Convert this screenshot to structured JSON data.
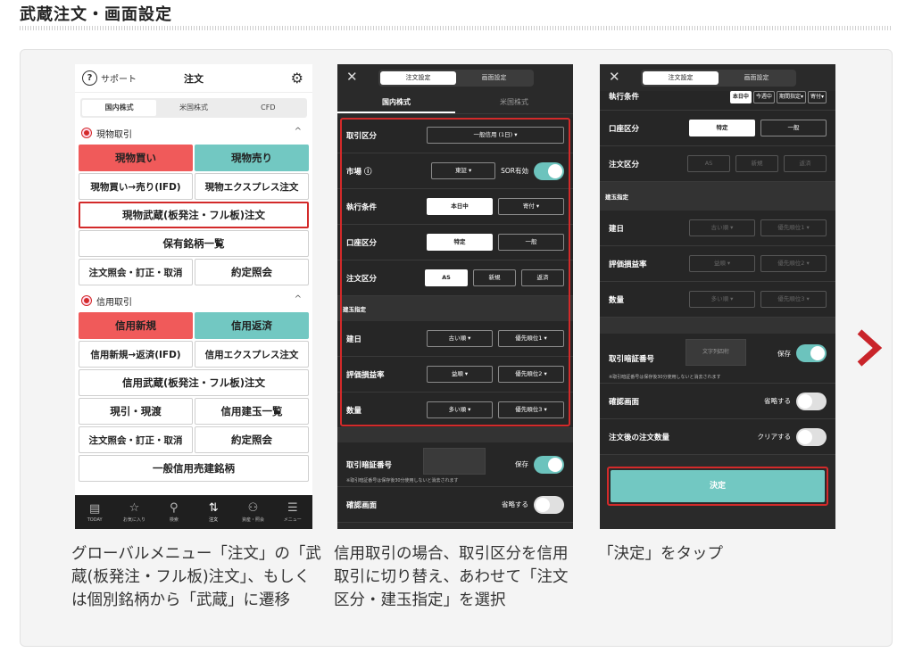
{
  "page_title": "武蔵注文・画面設定",
  "phone1": {
    "support_icon_text": "?",
    "support": "サポート",
    "title": "注文",
    "tabs": [
      "国内株式",
      "米国株式",
      "CFD"
    ],
    "section_cash": "現物取引",
    "cash_buttons": {
      "buy": "現物買い",
      "sell": "現物売り",
      "ifd": "現物買い→売り(IFD)",
      "express": "現物エクスプレス注文",
      "musashi": "現物武蔵(板発注・フル板)注文",
      "holdings": "保有銘柄一覧",
      "inquiry": "注文照会・訂正・取消",
      "execution": "約定照会"
    },
    "section_margin": "信用取引",
    "margin_buttons": {
      "new": "信用新規",
      "repay": "信用返済",
      "ifd": "信用新規→返済(IFD)",
      "express": "信用エクスプレス注文",
      "musashi": "信用武蔵(板発注・フル板)注文",
      "genbiki": "現引・現渡",
      "positions": "信用建玉一覧",
      "inquiry": "注文照会・訂正・取消",
      "execution": "約定照会",
      "short": "一般信用売建銘柄"
    },
    "tabbar": [
      "TODAY",
      "お気に入り",
      "検索",
      "注文",
      "資産・照会",
      "メニュー"
    ]
  },
  "phone2": {
    "pill": [
      "注文設定",
      "画面設定"
    ],
    "subtabs": [
      "国内株式",
      "米国株式"
    ],
    "torihiki_kubun": {
      "label": "取引区分",
      "value": "一般信用 (1日)"
    },
    "market": {
      "label": "市場",
      "value": "東証",
      "sor": "SOR有効"
    },
    "shikko": {
      "label": "執行条件",
      "opt1": "本日中",
      "opt2": "寄付"
    },
    "koza": {
      "label": "口座区分",
      "opt1": "特定",
      "opt2": "一般"
    },
    "chumon_kubun": {
      "label": "注文区分",
      "opt1": "AS",
      "opt2": "新規",
      "opt3": "返済"
    },
    "tategyoku": "建玉指定",
    "tatebi": {
      "label": "建日",
      "order": "古い順",
      "prio": "優先順位1"
    },
    "hyoka": {
      "label": "評価損益率",
      "order": "益順",
      "prio": "優先順位2"
    },
    "suryo": {
      "label": "数量",
      "order": "多い順",
      "prio": "優先順位3"
    },
    "pin": {
      "label": "取引暗証番号",
      "save": "保存",
      "note": "※取引暗証番号は保存後30分使用しないと消去されます"
    },
    "confirm": {
      "label": "確認画面",
      "value": "省略する"
    }
  },
  "phone3": {
    "pill": [
      "注文設定",
      "画面設定"
    ],
    "shikko": {
      "label": "執行条件",
      "opts": [
        "本日中",
        "今週中",
        "期間指定",
        "寄付"
      ]
    },
    "koza": {
      "label": "口座区分",
      "opt1": "特定",
      "opt2": "一般"
    },
    "chumon_kubun": {
      "label": "注文区分",
      "opt1": "AS",
      "opt2": "新規",
      "opt3": "返済"
    },
    "tategyoku": "建玉指定",
    "tatebi": {
      "label": "建日",
      "order": "古い順",
      "prio": "優先順位1"
    },
    "hyoka": {
      "label": "評価損益率",
      "order": "益順",
      "prio": "優先順位2"
    },
    "suryo": {
      "label": "数量",
      "order": "多い順",
      "prio": "優先順位3"
    },
    "pin": {
      "label": "取引暗証番号",
      "placeholder": "文字列四桁",
      "save": "保存",
      "note": "※取引暗証番号は保存後30分使用しないと消去されます"
    },
    "confirm": {
      "label": "確認画面",
      "value": "省略する"
    },
    "qty": {
      "label": "注文後の注文数量",
      "value": "クリアする"
    },
    "decide": "決定"
  },
  "captions": {
    "c1": "グローバルメニュー「注文」の「武蔵(板発注・フル板)注文」、もしくは個別銘柄から「武蔵」に遷移",
    "c2": "信用取引の場合、取引区分を信用取引に切り替え、あわせて「注文区分・建玉指定」を選択",
    "c3": "「決定」をタップ"
  },
  "colors": {
    "accent_teal": "#72c8c2",
    "buy_red": "#f05a5a",
    "highlight_red": "#d32a2a",
    "dark_bg": "#2a2a2a"
  }
}
